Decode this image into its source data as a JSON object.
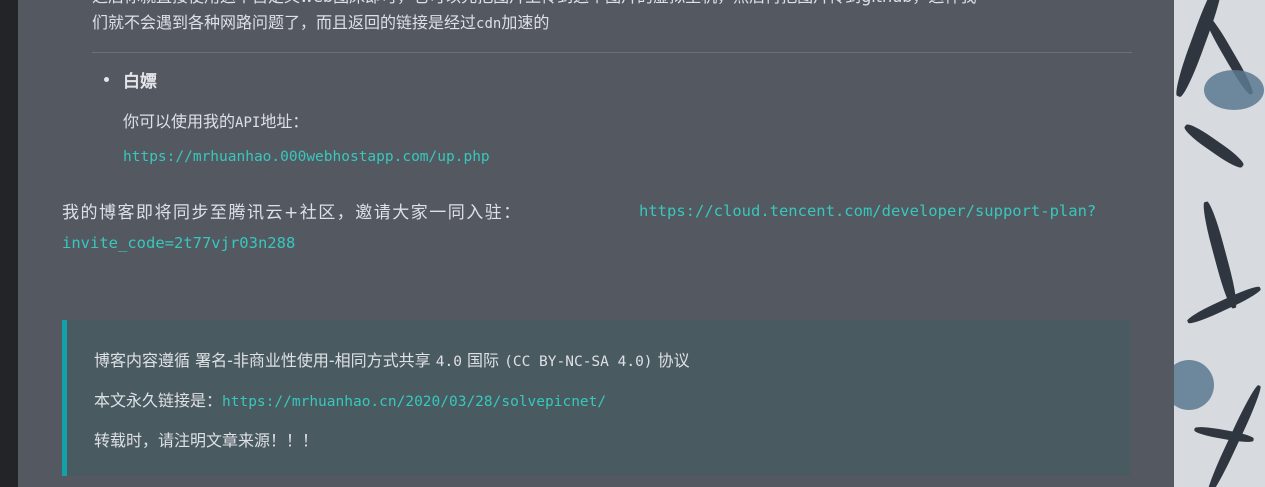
{
  "article": {
    "cut_line_1": "之后你就直接使用这个自定义web图床即可，它可以先把图片上传到这个图片的虚拟主机，然后再把图片传到github，这样我",
    "cut_line_2_a": "们就不会遇到各种网路问题了，而且返回的链接是经过",
    "cut_line_2_code": "cdn",
    "cut_line_2_b": "加速的",
    "item": {
      "title": "白嫖",
      "desc_a": "你可以使用我的",
      "desc_code": "API",
      "desc_b": "地址：",
      "link": "https://mrhuanhao.000webhostapp.com/up.php"
    },
    "invite": {
      "text": "我的博客即将同步至腾讯云+社区，邀请大家一同入驻：",
      "link_part1": "https://cloud.tencent.com/developer/support-plan?",
      "link_part2": "invite_code=2t77vjr03n288"
    }
  },
  "license": {
    "line1_a": "博客内容遵循 署名-非商业性使用-相同方式共享 ",
    "line1_b": "4.0",
    "line1_c": " 国际 ",
    "line1_d": "(CC BY-NC-SA 4.0)",
    "line1_e": " 协议",
    "line2_label": "本文永久链接是：",
    "line2_link": "https://mrhuanhao.cn/2020/03/28/solvepicnet/",
    "line3": "转载时，请注明文章来源！！！"
  },
  "colors": {
    "panel": "#545861",
    "link": "#37c8bd",
    "quote_bg": "#4a5a61",
    "quote_border": "#14a0a8"
  }
}
